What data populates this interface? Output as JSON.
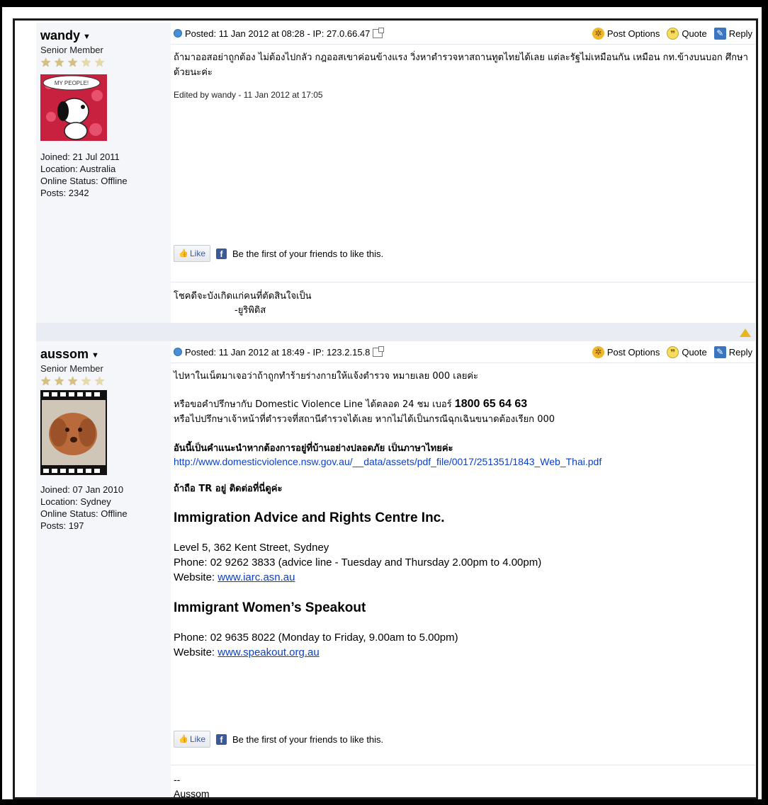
{
  "posts": [
    {
      "author": {
        "name": "wandy",
        "rank": "Senior Member",
        "stars_filled": 3,
        "stars_total": 5,
        "avatar_caption": "MY PEOPLE!",
        "joined": "Joined: 21 Jul 2011",
        "location": "Location: Australia",
        "status": "Online Status: Offline",
        "posts": "Posts: 2342"
      },
      "header": {
        "posted": "Posted: 11 Jan 2012 at 08:28 - IP: 27.0.66.47"
      },
      "message": "ถ้ามาออสอย่าถูกต้อง ไม่ต้องไปกลัว กฎออสเขาค่อนข้างแรง วิ่งหาตำรวจหาสถานทูตไทยได้เลย แต่ละรัฐไม่เหมือนกัน เหมือน กท.ข้างบนบอก ศึกษาด้วยนะค่ะ",
      "edited": "Edited by wandy - 11 Jan 2012 at 17:05",
      "signature_line1": "โชคดีจะบังเกิดแก่คนที่ตัดสินใจเป็น",
      "signature_line2": "-ยูริพิดิส"
    },
    {
      "author": {
        "name": "aussom",
        "rank": "Senior Member",
        "stars_filled": 3,
        "stars_total": 5,
        "joined": "Joined: 07 Jan 2010",
        "location": "Location: Sydney",
        "status": "Online Status: Offline",
        "posts": "Posts: 197"
      },
      "header": {
        "posted": "Posted: 11 Jan 2012 at 18:49 - IP: 123.2.15.8"
      },
      "line1": "ไปหาในเน็ตมาเจอว่าถ้าถูกทำร้ายร่างกายให้แจ้งตำรวจ หมายเลย 000 เลยค่ะ",
      "line2_prefix": "หรือขอคำปรึกษากับ Domestic Violence Line ได้ตลอด 24 ชม เบอร์",
      "line2_phone": "1800 65 64 63",
      "line3": "หรือไปปรึกษาเจ้าหน้าที่ตำรวจที่สถานีตำรวจได้เลย หากไม่ได้เป็นกรณีฉุกเฉินขนาดต้องเรียก 000",
      "bold_heading": "อันนี้เป็นคำแนะนำหากต้องการอยู่ที่บ้านอย่างปลอดภัย เป็นภาษาไทยค่ะ",
      "pdf_link": "http://www.domesticviolence.nsw.gov.au/__data/assets/pdf_file/0017/251351/1843_Web_Thai.pdf",
      "tr_heading": "ถ้าถือ TR อยู่ ติดต่อที่นี่ดูค่ะ",
      "org1": {
        "name": "Immigration Advice and Rights Centre Inc.",
        "address": "Level 5, 362 Kent Street, Sydney",
        "phone": "Phone: 02 9262 3833 (advice line - Tuesday and Thursday 2.00pm to 4.00pm)",
        "website_label": "Website:",
        "website": "www.iarc.asn.au"
      },
      "org2": {
        "name": "Immigrant Women’s Speakout",
        "phone": "Phone: 02 9635 8022 (Monday to Friday, 9.00am to 5.00pm)",
        "website_label": "Website:",
        "website": "www.speakout.org.au"
      },
      "signature_line1": "--",
      "signature_line2": "Aussom"
    }
  ],
  "common": {
    "post_options": "Post Options",
    "quote": "Quote",
    "reply": "Reply",
    "like": "Like",
    "like_text": "Be the first of your friends to like this."
  },
  "colors": {
    "link": "#0b3fc7",
    "author_bg": "#f4f6f9",
    "separator_bg": "#e9edf3",
    "facebook": "#3b5998",
    "back_to_top": "#e7b722"
  }
}
